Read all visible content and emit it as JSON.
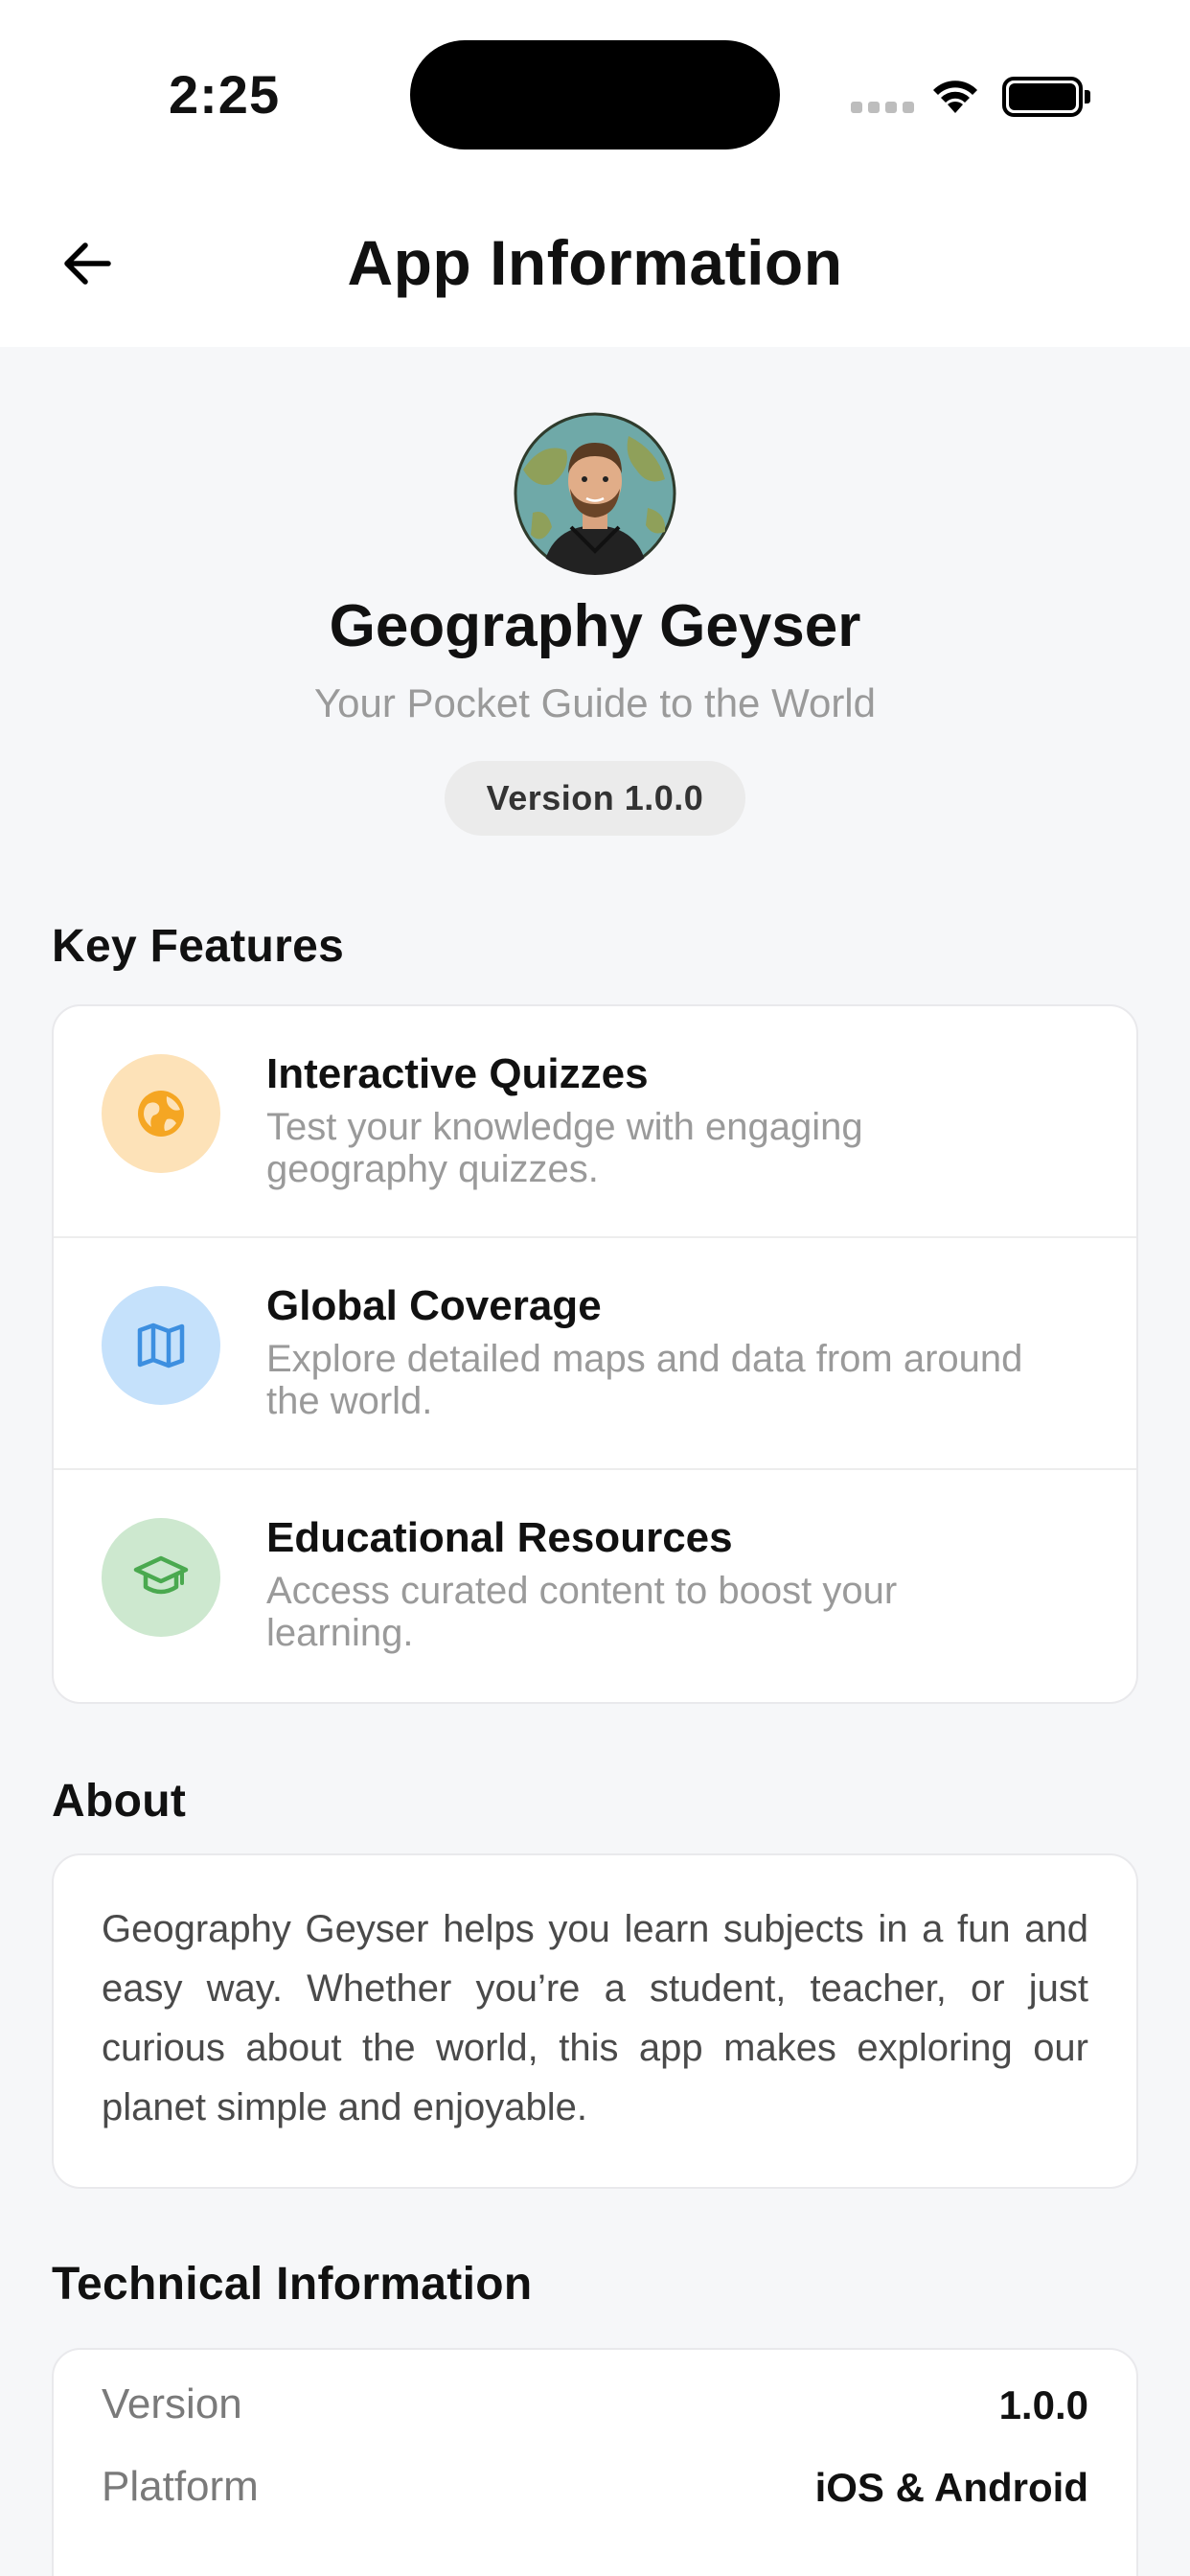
{
  "status_bar": {
    "time": "2:25"
  },
  "header": {
    "title": "App Information",
    "back_icon": "arrow-left-icon"
  },
  "app": {
    "name": "Geography Geyser",
    "tagline": "Your Pocket Guide to the World",
    "version_badge": "Version 1.0.0",
    "avatar_icon": "developer-avatar-globe"
  },
  "features": {
    "title": "Key Features",
    "items": [
      {
        "title": "Interactive Quizzes",
        "description": "Test your knowledge with engaging geography quizzes.",
        "icon": "globe-icon",
        "icon_color": "#f5a623",
        "bg_color": "#fde2b8"
      },
      {
        "title": "Global Coverage",
        "description": "Explore detailed maps and data from around the world.",
        "icon": "map-icon",
        "icon_color": "#3d8fe0",
        "bg_color": "#c5e1fb"
      },
      {
        "title": "Educational Resources",
        "description": "Access curated content to boost your learning.",
        "icon": "graduation-cap-icon",
        "icon_color": "#4aa94f",
        "bg_color": "#cde8cf"
      }
    ]
  },
  "about": {
    "title": "About",
    "text": "Geography Geyser helps you learn subjects in a fun and easy way. Whether you’re a student, teacher, or just curious about the world, this app makes exploring our planet simple and enjoyable."
  },
  "technical": {
    "title": "Technical Information",
    "rows": [
      {
        "label": "Version",
        "value": "1.0.0"
      },
      {
        "label": "Platform",
        "value": "iOS & Android"
      }
    ]
  }
}
